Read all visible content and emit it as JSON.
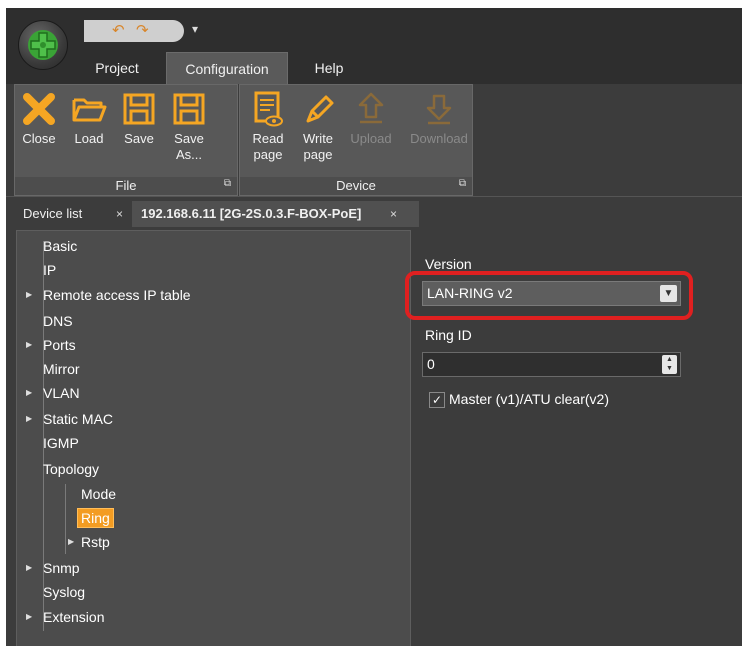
{
  "ribbon": {
    "tabs": [
      {
        "label": "Project"
      },
      {
        "label": "Configuration"
      },
      {
        "label": "Help"
      }
    ],
    "file_group": {
      "label": "File",
      "buttons": [
        {
          "label": "Close",
          "icon": "close-icon"
        },
        {
          "label": "Load",
          "icon": "folder-open-icon"
        },
        {
          "label": "Save",
          "icon": "save-icon"
        },
        {
          "label": "Save\nAs...",
          "icon": "save-as-icon"
        }
      ]
    },
    "device_group": {
      "label": "Device",
      "buttons": [
        {
          "label": "Read\npage",
          "icon": "read-page-icon"
        },
        {
          "label": "Write\npage",
          "icon": "write-page-icon"
        },
        {
          "label": "Upload",
          "icon": "upload-icon",
          "enabled": false
        },
        {
          "label": "Download",
          "icon": "download-icon",
          "enabled": false
        }
      ]
    }
  },
  "doc_tabs": [
    {
      "label": "Device list",
      "close": "×"
    },
    {
      "label": "192.168.6.11 [2G-2S.0.3.F-BOX-PoE]",
      "close": "×"
    }
  ],
  "tree": {
    "items": [
      {
        "label": "Basic"
      },
      {
        "label": "IP"
      },
      {
        "label": "Remote access IP table"
      },
      {
        "label": "DNS"
      },
      {
        "label": "Ports"
      },
      {
        "label": "Mirror"
      },
      {
        "label": "VLAN"
      },
      {
        "label": "Static MAC"
      },
      {
        "label": "IGMP"
      },
      {
        "label": "Topology"
      },
      {
        "label": "Mode"
      },
      {
        "label": "Ring",
        "selected": true
      },
      {
        "label": "Rstp"
      },
      {
        "label": "Snmp"
      },
      {
        "label": "Syslog"
      },
      {
        "label": "Extension"
      }
    ]
  },
  "settings": {
    "version_label": "Version",
    "version_value": "LAN-RING v2",
    "ring_id_label": "Ring ID",
    "ring_id_value": "0",
    "master_label": "Master (v1)/ATU clear(v2)",
    "master_checked": true
  },
  "colors": {
    "highlight": "#e02020",
    "selection": "#f39c22",
    "icon": "#f5a623"
  }
}
